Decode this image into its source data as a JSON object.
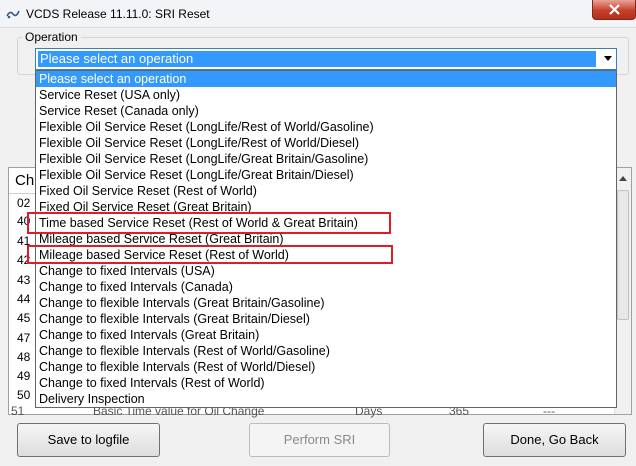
{
  "window": {
    "title": "VCDS Release 11.11.0:  SRI Reset"
  },
  "operation": {
    "label": "Operation",
    "selected": "Please select an operation",
    "options": [
      "Please select an operation",
      "Service Reset (USA only)",
      "Service Reset (Canada only)",
      "Flexible Oil Service Reset (LongLife/Rest of World/Gasoline)",
      "Flexible Oil Service Reset (LongLife/Rest of World/Diesel)",
      "Flexible Oil Service Reset (LongLife/Great Britain/Gasoline)",
      "Flexible Oil Service Reset (LongLife/Great Britain/Diesel)",
      "Fixed Oil Service Reset (Rest of World)",
      "Fixed Oil Service Reset (Great Britain)",
      "Time based Service Reset (Rest of World & Great Britain)",
      "Mileage based Service Reset (Great Britain)",
      "Mileage based Service Reset (Rest of World)",
      "Change to fixed Intervals (USA)",
      "Change to fixed Intervals (Canada)",
      "Change to flexible Intervals (Great Britain/Gasoline)",
      "Change to flexible Intervals (Great Britain/Diesel)",
      "Change to fixed Intervals (Great Britain)",
      "Change to flexible Intervals (Rest of World/Gasoline)",
      "Change to flexible Intervals (Rest of World/Diesel)",
      "Change to fixed Intervals (Rest of World)",
      "Delivery Inspection"
    ]
  },
  "table": {
    "header_partial": "Ch",
    "row_numbers": [
      "02",
      "40",
      "41",
      "42",
      "43",
      "44",
      "45",
      "47",
      "48",
      "49",
      "50",
      "51"
    ],
    "last_row": {
      "num": "51",
      "name": "Basic Time value for Oil Change",
      "unit": "Days",
      "value": "365",
      "new": "---"
    }
  },
  "buttons": {
    "save": "Save to logfile",
    "perform": "Perform SRI",
    "done": "Done, Go Back"
  },
  "colors": {
    "selection": "#3399ff",
    "highlight_box": "#d8202a",
    "close_button": "#c7402c"
  },
  "icons": {
    "app": "vcds-app-icon",
    "close": "close-icon",
    "dropdown_arrow": "chevron-down-icon"
  }
}
